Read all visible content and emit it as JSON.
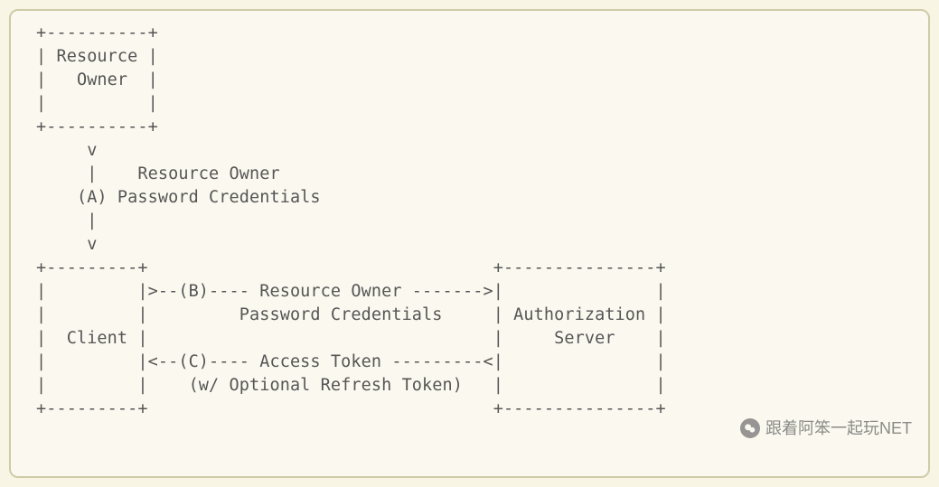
{
  "diagram": {
    "lines": [
      "+----------+",
      "| Resource |",
      "|   Owner  |",
      "|          |",
      "+----------+",
      "     v",
      "     |    Resource Owner",
      "    (A) Password Credentials",
      "     |",
      "     v",
      "+---------+                                  +---------------+",
      "|         |>--(B)---- Resource Owner ------->|               |",
      "|         |         Password Credentials     | Authorization |",
      "|  Client |                                  |     Server    |",
      "|         |<--(C)---- Access Token ---------<|               |",
      "|         |    (w/ Optional Refresh Token)   |               |",
      "+---------+                                  +---------------+"
    ],
    "boxes": {
      "resource_owner": "Resource Owner",
      "client": "Client",
      "authorization_server": "Authorization Server"
    },
    "flows": {
      "A": {
        "label": "(A)",
        "text": "Resource Owner Password Credentials",
        "from": "Resource Owner",
        "to": "Client"
      },
      "B": {
        "label": "(B)",
        "text": "Resource Owner Password Credentials",
        "from": "Client",
        "to": "Authorization Server"
      },
      "C": {
        "label": "(C)",
        "text": "Access Token (w/ Optional Refresh Token)",
        "from": "Authorization Server",
        "to": "Client"
      }
    }
  },
  "watermark": {
    "text": "跟着阿笨一起玩NET"
  }
}
